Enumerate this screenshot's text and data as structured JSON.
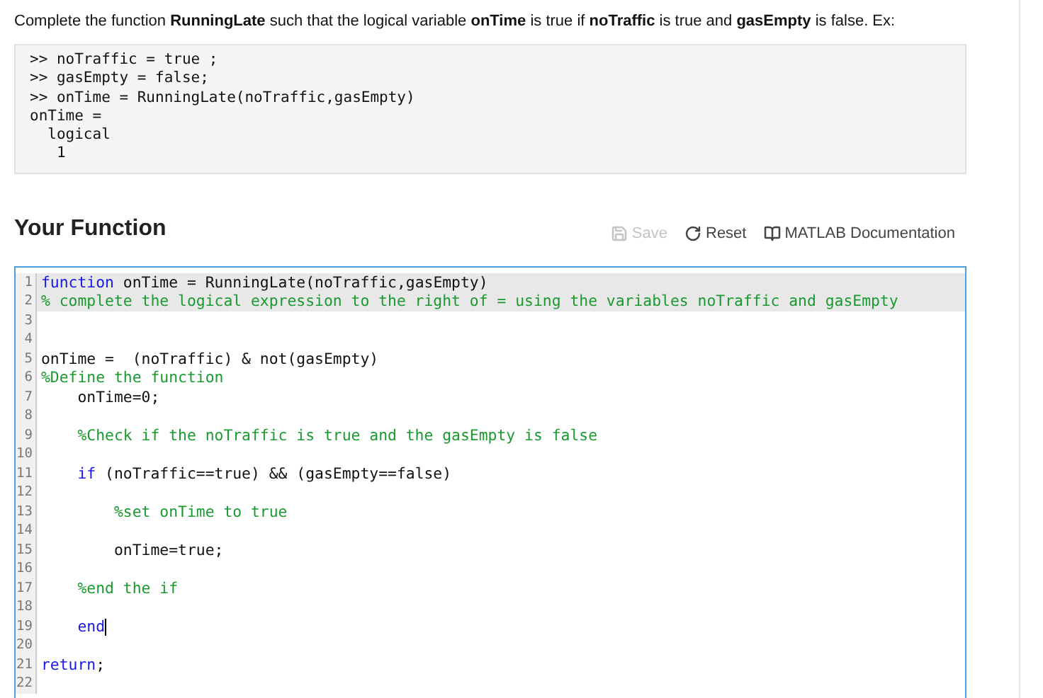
{
  "instructions": "Complete the function **RunningLate** such that the logical variable **onTime** is true if **noTraffic** is true and **gasEmpty** is false.  Ex:",
  "example": [
    ">> noTraffic = true ;",
    ">> gasEmpty = false;",
    ">> onTime = RunningLate(noTraffic,gasEmpty)",
    "onTime =",
    "  logical",
    "   1"
  ],
  "section_title": "Your Function",
  "toolbar": [
    {
      "kind": "save",
      "label": "Save",
      "disabled": true
    },
    {
      "kind": "reset",
      "label": "Reset",
      "disabled": false
    },
    {
      "kind": "docs",
      "label": "MATLAB Documentation",
      "disabled": false
    }
  ],
  "editor": {
    "lines": [
      {
        "number": "1",
        "readonly": true,
        "cursor": false,
        "tokens": [
          {
            "kind": "keyword",
            "text": "function"
          },
          {
            "kind": "plain",
            "text": " onTime = RunningLate(noTraffic,gasEmpty)"
          }
        ]
      },
      {
        "number": "2",
        "readonly": true,
        "cursor": false,
        "tokens": [
          {
            "kind": "comment",
            "text": "% complete the logical expression to the right of = using the variables noTraffic and gasEmpty"
          }
        ]
      },
      {
        "number": "3",
        "readonly": false,
        "cursor": false
      },
      {
        "number": "4",
        "readonly": false,
        "cursor": false
      },
      {
        "number": "5",
        "readonly": false,
        "cursor": false,
        "tokens": [
          {
            "kind": "plain",
            "text": "onTime =  (noTraffic) & not(gasEmpty)"
          }
        ]
      },
      {
        "number": "6",
        "readonly": false,
        "cursor": false,
        "tokens": [
          {
            "kind": "comment",
            "text": "%Define the function"
          }
        ]
      },
      {
        "number": "7",
        "readonly": false,
        "cursor": false,
        "tokens": [
          {
            "kind": "plain",
            "text": "    onTime=0;"
          }
        ]
      },
      {
        "number": "8",
        "readonly": false,
        "cursor": false
      },
      {
        "number": "9",
        "readonly": false,
        "cursor": false,
        "tokens": [
          {
            "kind": "comment",
            "text": "    %Check if the noTraffic is true and the gasEmpty is false"
          }
        ]
      },
      {
        "number": "10",
        "readonly": false,
        "cursor": false
      },
      {
        "number": "11",
        "readonly": false,
        "cursor": false,
        "tokens": [
          {
            "kind": "keyword",
            "text": "    if"
          },
          {
            "kind": "plain",
            "text": " (noTraffic==true) && (gasEmpty==false)"
          }
        ]
      },
      {
        "number": "12",
        "readonly": false,
        "cursor": false
      },
      {
        "number": "13",
        "readonly": false,
        "cursor": false,
        "tokens": [
          {
            "kind": "comment",
            "text": "        %set onTime to true"
          }
        ]
      },
      {
        "number": "14",
        "readonly": false,
        "cursor": false
      },
      {
        "number": "15",
        "readonly": false,
        "cursor": false,
        "tokens": [
          {
            "kind": "plain",
            "text": "        onTime=true;"
          }
        ]
      },
      {
        "number": "16",
        "readonly": false,
        "cursor": false
      },
      {
        "number": "17",
        "readonly": false,
        "cursor": false,
        "tokens": [
          {
            "kind": "comment",
            "text": "    %end the if"
          }
        ]
      },
      {
        "number": "18",
        "readonly": false,
        "cursor": false
      },
      {
        "number": "19",
        "readonly": false,
        "cursor": true,
        "tokens": [
          {
            "kind": "keyword",
            "text": "    end"
          }
        ]
      },
      {
        "number": "20",
        "readonly": false,
        "cursor": false
      },
      {
        "number": "21",
        "readonly": false,
        "cursor": false,
        "tokens": [
          {
            "kind": "keyword",
            "text": "return"
          },
          {
            "kind": "plain",
            "text": ";"
          }
        ]
      },
      {
        "number": "22",
        "readonly": false,
        "cursor": false
      }
    ]
  }
}
